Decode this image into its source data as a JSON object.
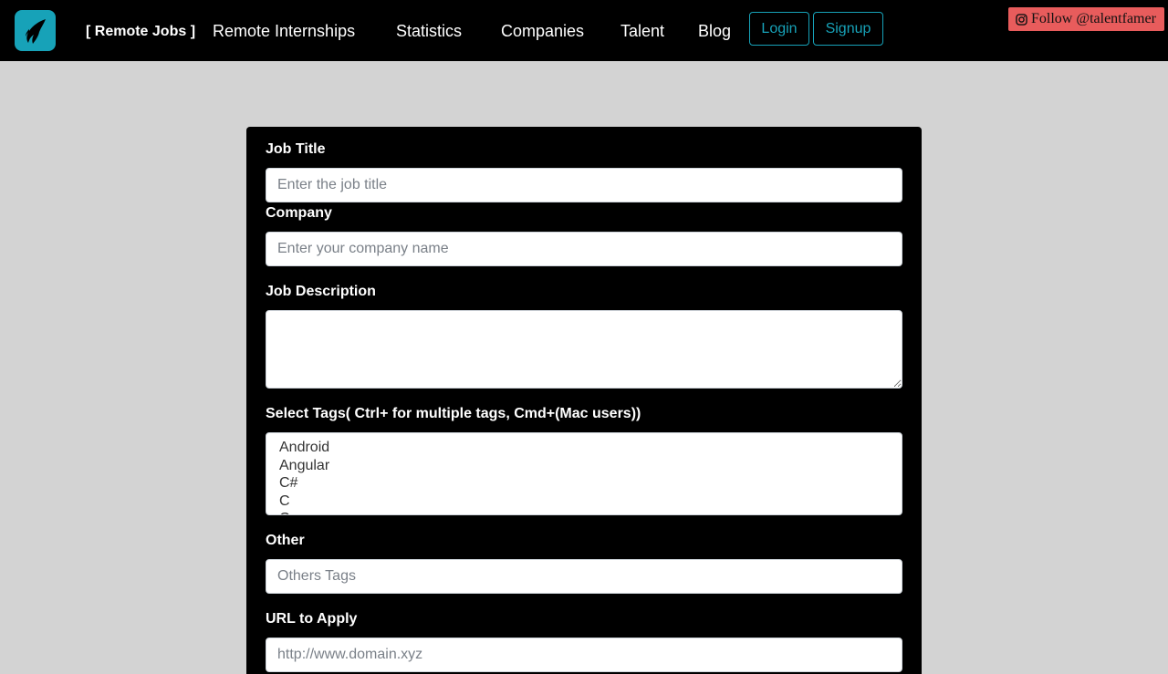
{
  "nav": {
    "logo_icon": "feather-flame-icon",
    "active_link": "[ Remote Jobs ]",
    "links": [
      "Remote Internships",
      "Statistics",
      "Companies",
      "Talent",
      "Blog"
    ],
    "login_label": "Login",
    "signup_label": "Signup",
    "follow_label": "Follow @talentfamer",
    "follow_icon": "instagram-icon"
  },
  "form": {
    "job_title": {
      "label": "Job Title",
      "placeholder": "Enter the job title",
      "value": ""
    },
    "company": {
      "label": "Company",
      "placeholder": "Enter your company name",
      "value": ""
    },
    "description": {
      "label": "Job Description",
      "value": ""
    },
    "tags": {
      "label": "Select Tags( Ctrl+ for multiple tags, Cmd+(Mac users))",
      "options": [
        "Android",
        "Angular",
        "C#",
        "C",
        "C"
      ]
    },
    "other": {
      "label": "Other",
      "placeholder": "Others Tags",
      "value": ""
    },
    "url": {
      "label": "URL to Apply",
      "placeholder": "http://www.domain.xyz",
      "value": ""
    }
  },
  "colors": {
    "accent": "#17a2b8",
    "navbar": "#000000",
    "page_background": "#d3d3d3",
    "follow_button": "#e85c5c"
  }
}
